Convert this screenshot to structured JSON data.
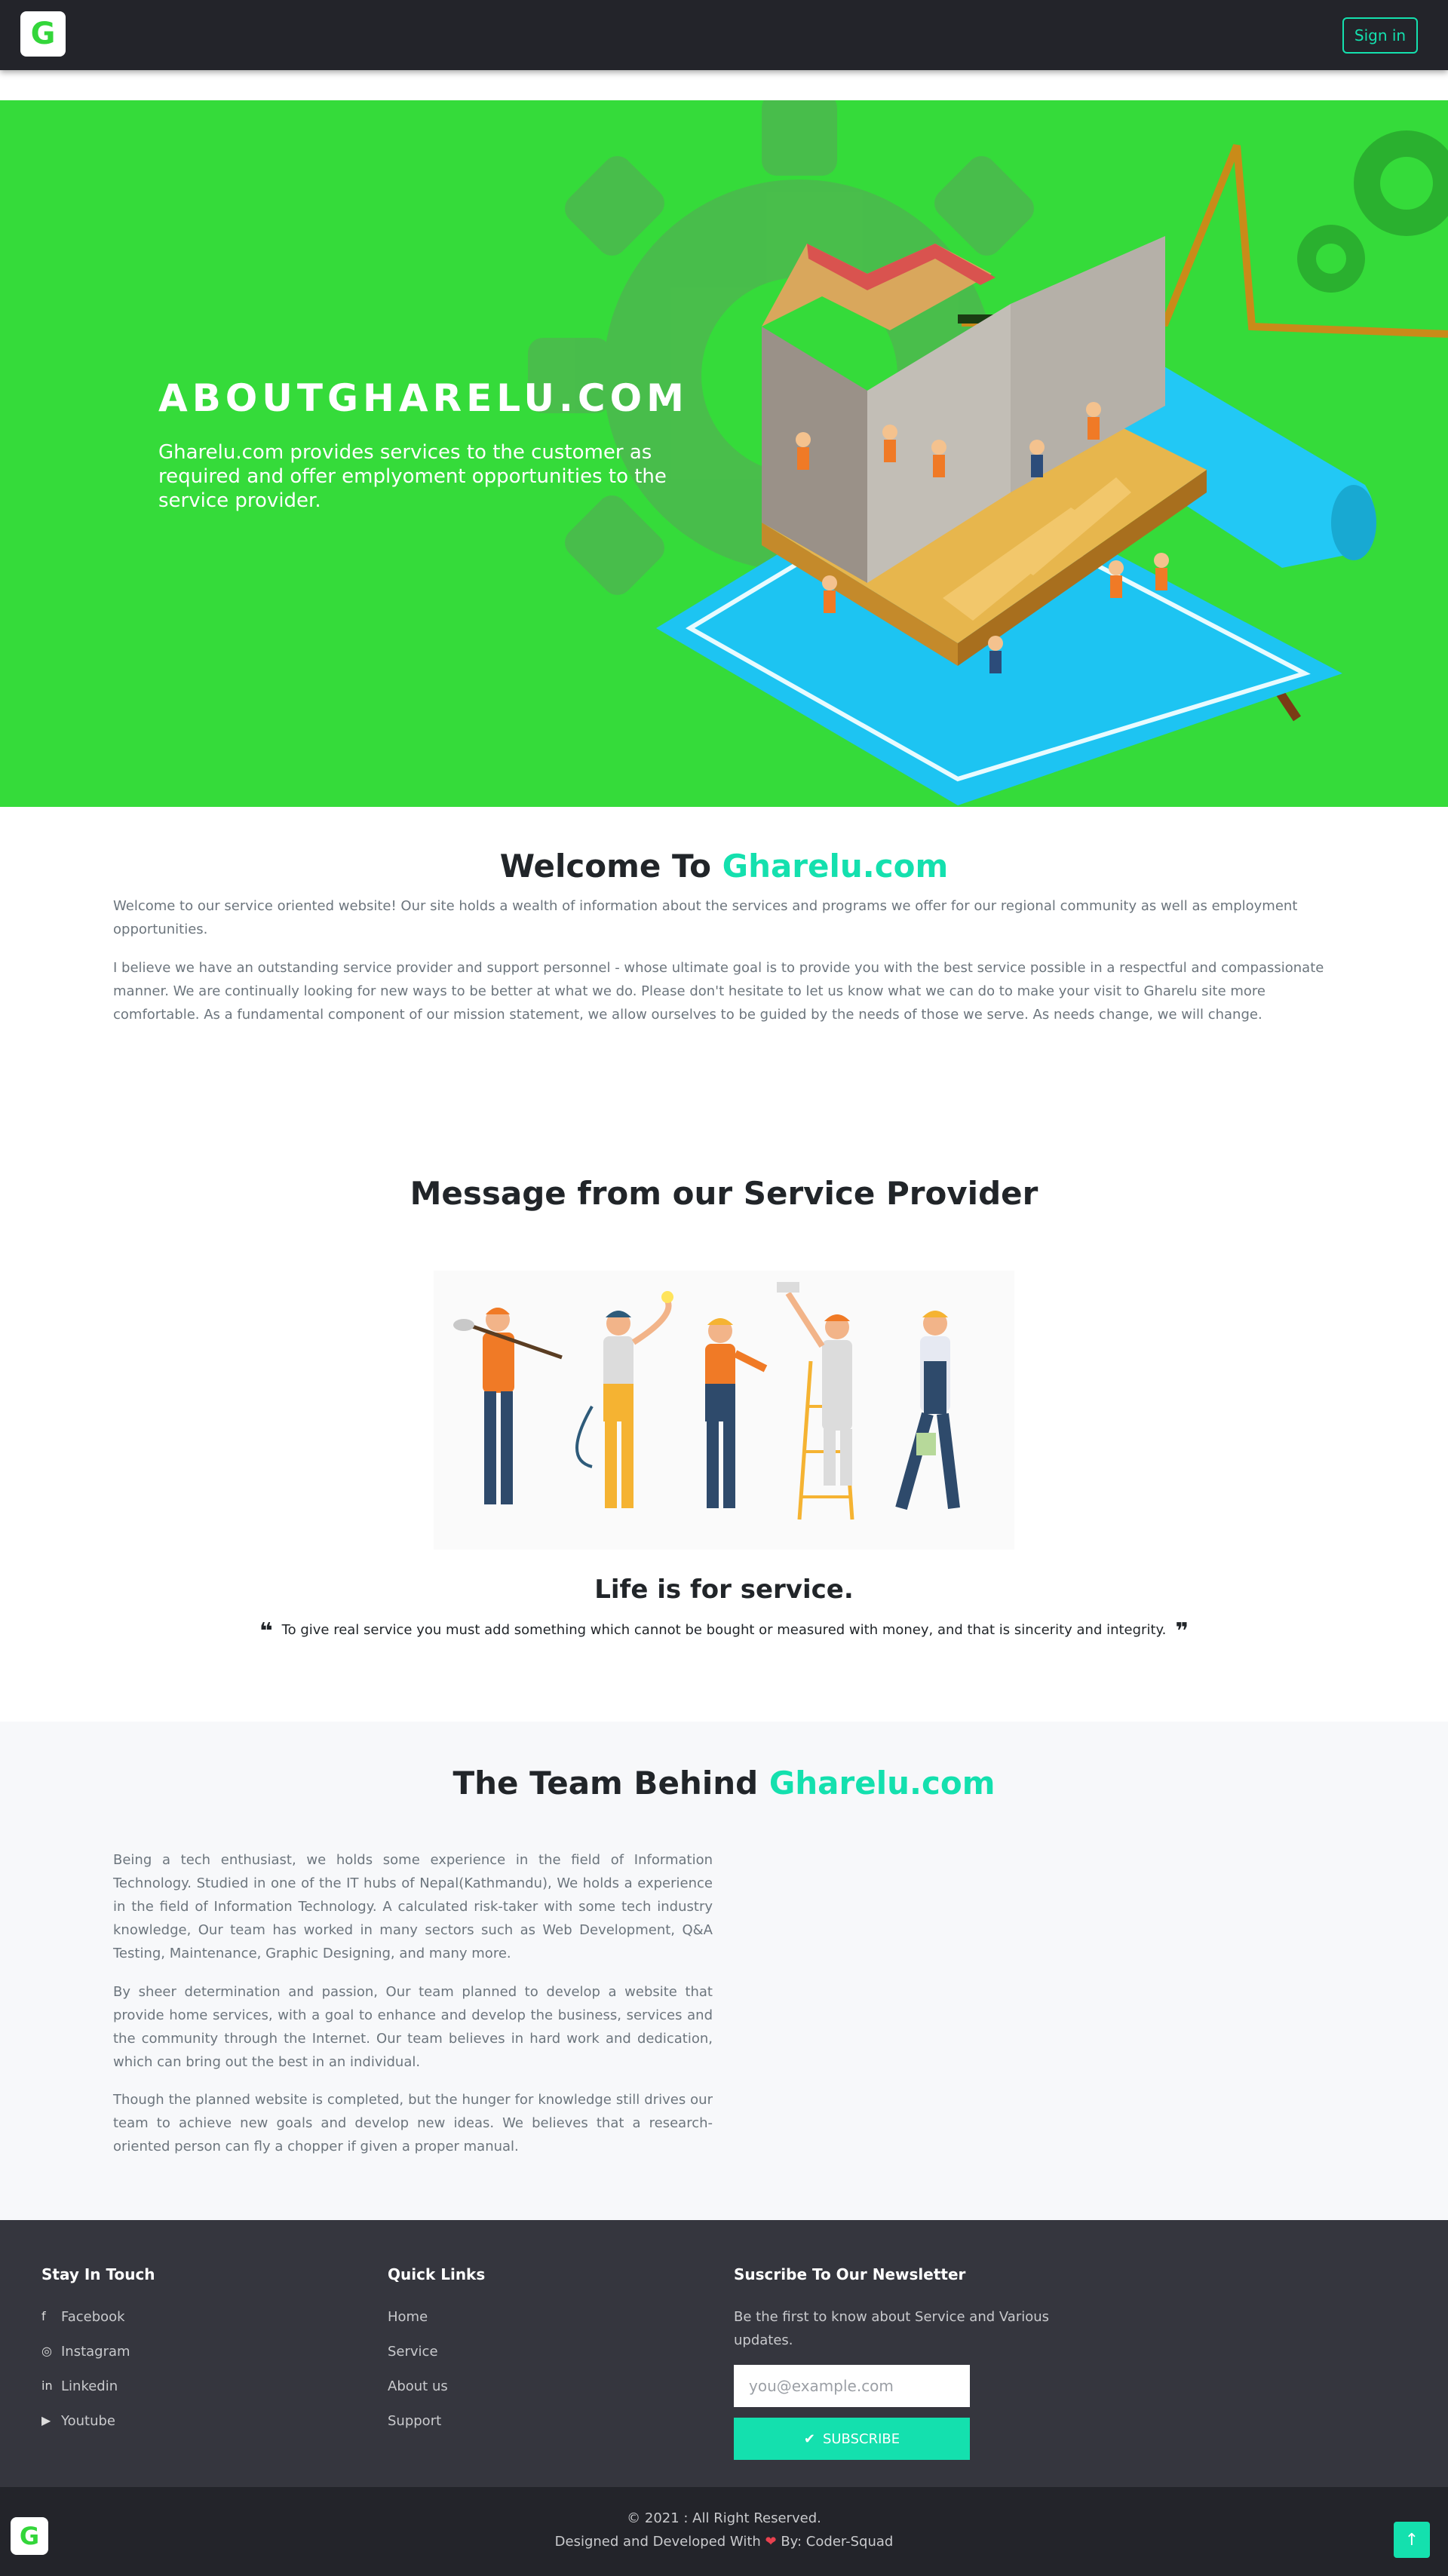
{
  "brand": {
    "logo_letter": "G",
    "accent_color": "#14e0ae",
    "hero_color": "#35db3a"
  },
  "nav": {
    "signin_label": "Sign in"
  },
  "hero": {
    "title": "ABOUTGHARELU.COM",
    "subtitle": "Gharelu.com provides services to the customer as required and offer emplyoment opportunities to the service provider.",
    "illustration": "house-construction-illustration"
  },
  "welcome": {
    "title_prefix": "Welcome To ",
    "title_accent": "Gharelu.com",
    "p1": "Welcome to our service oriented website! Our site holds a wealth of information about the services and programs we offer for our regional community as well as employment opportunities.",
    "p2": "I believe we have an outstanding service provider and support personnel - whose ultimate goal is to provide you with the best service possible in a respectful and compassionate manner. We are continually looking for new ways to be better at what we do. Please don't hesitate to let us know what we can do to make your visit to Gharelu site more comfortable. As a fundamental component of our mission statement, we allow ourselves to be guided by the needs of those we serve. As needs change, we will change."
  },
  "message": {
    "title": "Message from our Service Provider",
    "image": "service-workers-illustration",
    "quote_title": "Life is for service.",
    "quote": "To give real service you must add something which cannot be bought or measured with money, and that is sincerity and integrity.",
    "quote_open_icon": "quote-left-icon",
    "quote_close_icon": "quote-right-icon"
  },
  "team": {
    "title_prefix": "The Team Behind ",
    "title_accent": "Gharelu.com",
    "p1": "Being a tech enthusiast, we holds some experience in the field of Information Technology. Studied in one of the IT hubs of Nepal(Kathmandu), We holds a experience in the field of Information Technology. A calculated risk-taker with some tech industry knowledge, Our team has worked in many sectors such as Web Development, Q&A Testing, Maintenance, Graphic Designing, and many more.",
    "p2": "By sheer determination and passion, Our team planned to develop a website that provide home services, with a goal to enhance and develop the business, services and the community through the Internet. Our team believes in hard work and dedication, which can bring out the best in an individual.",
    "p3": "Though the planned website is completed, but the hunger for knowledge still drives our team to achieve new goals and develop new ideas. We believes that a research-oriented person can fly a chopper if given a proper manual."
  },
  "footer": {
    "stay_title": "Stay In Touch",
    "social": [
      {
        "label": "Facebook",
        "icon": "facebook-icon"
      },
      {
        "label": "Instagram",
        "icon": "instagram-icon"
      },
      {
        "label": "Linkedin",
        "icon": "linkedin-icon"
      },
      {
        "label": "Youtube",
        "icon": "youtube-icon"
      }
    ],
    "links_title": "Quick Links",
    "links": [
      "Home",
      "Service",
      "About us",
      "Support"
    ],
    "newsletter_title": "Suscribe To Our Newsletter",
    "newsletter_text": "Be the first to know about Service and Various updates.",
    "email_placeholder": "you@example.com",
    "subscribe_label": "SUBSCRIBE",
    "copyright": "© 2021 : All Right Reserved.",
    "credit_prefix": "Designed and Developed With ",
    "credit_suffix": " By: Coder-Squad"
  }
}
